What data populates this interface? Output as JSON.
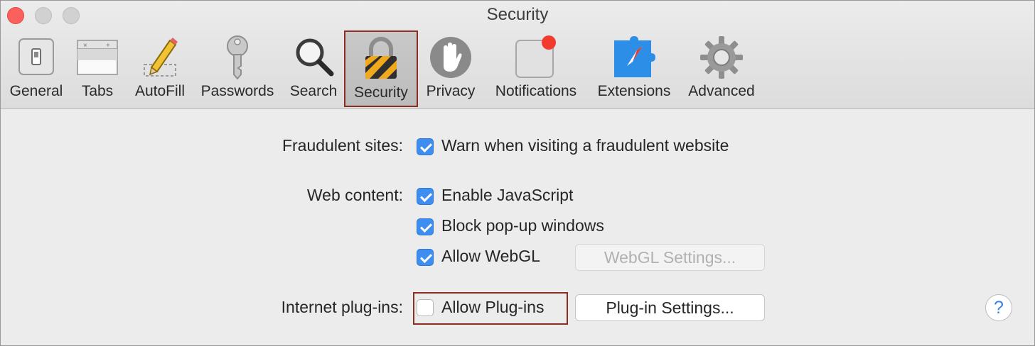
{
  "window": {
    "title": "Security"
  },
  "toolbar": {
    "items": [
      {
        "label": "General",
        "icon": "general-switch-icon"
      },
      {
        "label": "Tabs",
        "icon": "tabs-icon"
      },
      {
        "label": "AutoFill",
        "icon": "pencil-icon"
      },
      {
        "label": "Passwords",
        "icon": "key-icon"
      },
      {
        "label": "Search",
        "icon": "magnifier-icon"
      },
      {
        "label": "Security",
        "icon": "padlock-icon",
        "selected": true
      },
      {
        "label": "Privacy",
        "icon": "hand-icon"
      },
      {
        "label": "Notifications",
        "icon": "notification-badge-icon"
      },
      {
        "label": "Extensions",
        "icon": "puzzle-compass-icon"
      },
      {
        "label": "Advanced",
        "icon": "gear-icon"
      }
    ]
  },
  "settings": {
    "fraudulent": {
      "label": "Fraudulent sites:",
      "option": {
        "text": "Warn when visiting a fraudulent website",
        "checked": true
      }
    },
    "web_content": {
      "label": "Web content:",
      "javascript": {
        "text": "Enable JavaScript",
        "checked": true
      },
      "popups": {
        "text": "Block pop-up windows",
        "checked": true
      },
      "webgl": {
        "text": "Allow WebGL",
        "checked": true
      },
      "webgl_button": "WebGL Settings..."
    },
    "plugins": {
      "label": "Internet plug-ins:",
      "option": {
        "text": "Allow Plug-ins",
        "checked": false
      },
      "settings_button": "Plug-in Settings..."
    }
  },
  "help": {
    "glyph": "?"
  },
  "colors": {
    "accent": "#3d8ef0",
    "highlight_border": "#8b2f25",
    "close_button": "#fc605c"
  }
}
